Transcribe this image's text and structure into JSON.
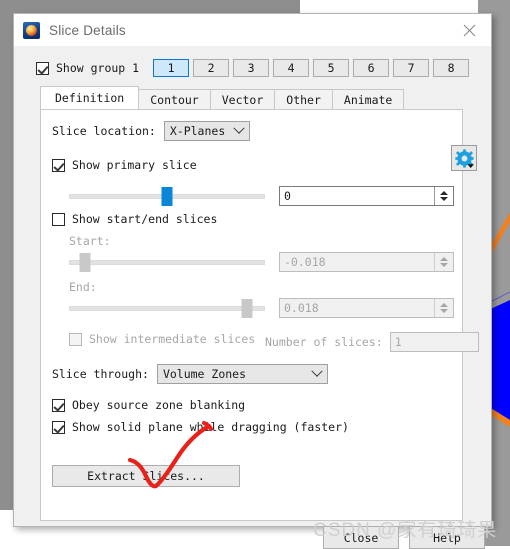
{
  "window": {
    "title": "Slice Details",
    "app_icon": "teapot-icon",
    "close_icon": "close-icon"
  },
  "group": {
    "checkbox_label": "Show group 1",
    "checked": true,
    "buttons": [
      "1",
      "2",
      "3",
      "4",
      "5",
      "6",
      "7",
      "8"
    ],
    "selected": "1"
  },
  "tabs": [
    {
      "label": "Definition",
      "active": true
    },
    {
      "label": "Contour",
      "active": false
    },
    {
      "label": "Vector",
      "active": false
    },
    {
      "label": "Other",
      "active": false
    },
    {
      "label": "Animate",
      "active": false
    }
  ],
  "definition": {
    "slice_location_label": "Slice location:",
    "slice_location_value": "X-Planes",
    "show_primary_slice_label": "Show primary slice",
    "show_primary_slice_checked": true,
    "primary_value": "0",
    "primary_slider_percent": 50,
    "gear_icon": "gear-icon",
    "show_start_end_label": "Show start/end slices",
    "show_start_end_checked": false,
    "start_label": "Start:",
    "start_value": "-0.018",
    "start_slider_percent": 8,
    "end_label": "End:",
    "end_value": "0.018",
    "end_slider_percent": 91,
    "show_intermediate_label": "Show intermediate slices",
    "show_intermediate_checked": false,
    "number_of_slices_label": "Number of slices:",
    "number_of_slices_value": "1",
    "slice_through_label": "Slice through:",
    "slice_through_value": "Volume Zones",
    "obey_blanking_label": "Obey source zone blanking",
    "obey_blanking_checked": true,
    "solid_plane_label": "Show solid plane while dragging (faster)",
    "solid_plane_checked": true,
    "extract_label": "Extract Slices..."
  },
  "footer": {
    "close_label": "Close",
    "help_label": "Help"
  },
  "overlay": {
    "watermark": "CSDN @家有琦琦果",
    "annotation": "red-checkmark-annotation"
  },
  "colors": {
    "accent_blue": "#0a86d8",
    "selected_tab_blue": "#cde8fb",
    "annotation_red": "#e8221a",
    "viewport_blue": "#0000ff",
    "viewport_orange": "#f08020"
  }
}
